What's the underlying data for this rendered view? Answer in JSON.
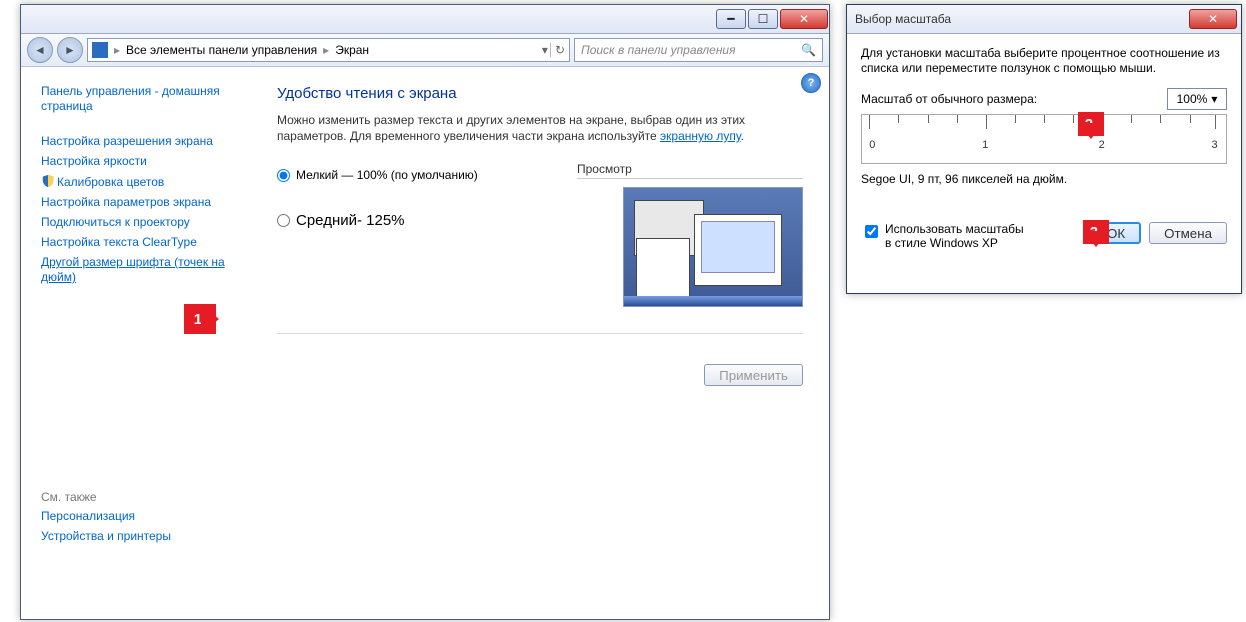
{
  "window1": {
    "breadcrumb": {
      "root": "Все элементы панели управления",
      "leaf": "Экран"
    },
    "search_placeholder": "Поиск в панели управления",
    "side": {
      "home": "Панель управления - домашняя страница",
      "links": [
        "Настройка разрешения экрана",
        "Настройка яркости",
        "Калибровка цветов",
        "Настройка параметров экрана",
        "Подключиться к проектору",
        "Настройка текста ClearType",
        "Другой размер шрифта (точек на дюйм)"
      ],
      "see_also_title": "См. также",
      "see_also": [
        "Персонализация",
        "Устройства и принтеры"
      ]
    },
    "main": {
      "title": "Удобство чтения с экрана",
      "desc_before": "Можно изменить размер текста и других элементов на экране, выбрав один из этих параметров. Для временного увеличения части экрана используйте ",
      "desc_link": "экранную лупу",
      "desc_after": ".",
      "opt_small": "Мелкий — 100% (по умолчанию)",
      "opt_medium": "Средний- 125%",
      "preview_label": "Просмотр",
      "apply": "Применить"
    }
  },
  "dialog": {
    "title": "Выбор масштаба",
    "instr": "Для установки масштаба выберите процентное соотношение из списка или переместите ползунок с помощью мыши.",
    "scale_label": "Масштаб от обычного размера:",
    "scale_value": "100%",
    "ruler": [
      "0",
      "1",
      "2",
      "3"
    ],
    "preview_font": "Segoe UI, 9 пт, 96 пикселей на дюйм.",
    "xp_check": "Использовать масштабы в стиле Windows XP",
    "ok": "ОК",
    "cancel": "Отмена"
  },
  "arrows": {
    "a1": "1.",
    "a2": "2.",
    "a3": "3."
  }
}
